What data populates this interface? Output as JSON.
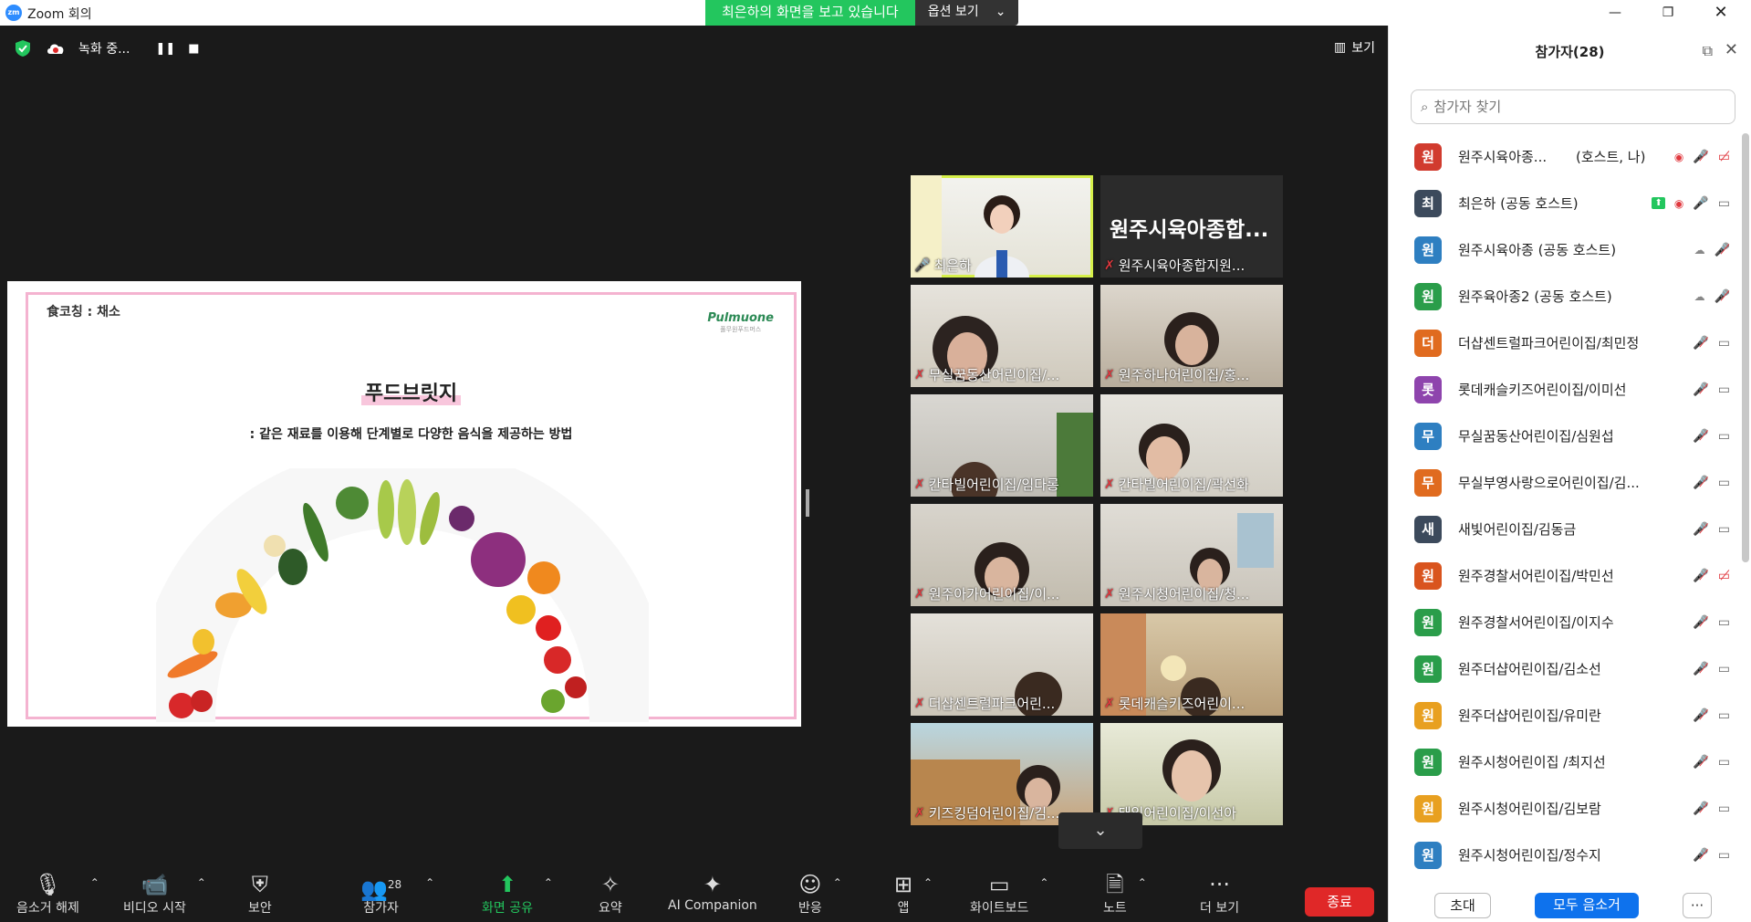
{
  "window": {
    "title": "Zoom 회의",
    "logo_text": "zm"
  },
  "share_banner": {
    "message": "최은하의 화면을 보고 있습니다",
    "options_label": "옵션 보기"
  },
  "recording": {
    "status": "녹화 중..."
  },
  "view_button": {
    "label": "보기"
  },
  "slide": {
    "tag": "食코칭 : 채소",
    "brand": "Pulmuone",
    "brand_sub": "풀무원푸드머스",
    "heading": "푸드브릿지",
    "subtitle": ": 같은 재료를 이용해 단계별로 다양한 음식을 제공하는 방법"
  },
  "tiles": [
    {
      "name": "최은하",
      "active_speaker": true
    },
    {
      "name": "원주시육아종합지원...",
      "big": "원주시육아종합..."
    },
    {
      "name": "무실꿈동산어린이집/..."
    },
    {
      "name": "원주하나어린이집/홍..."
    },
    {
      "name": "칸타빌어린이집/임다롱"
    },
    {
      "name": "칸타빌어린이집/곽선화"
    },
    {
      "name": "원주아가어린이집/이..."
    },
    {
      "name": "원주시청어린이집/청..."
    },
    {
      "name": "더샵센트럴파크어린..."
    },
    {
      "name": "롯데캐슬키즈어린이..."
    },
    {
      "name": "키즈킹덤어린이집/김..."
    },
    {
      "name": "태일어린이집/이선아"
    }
  ],
  "toolbar": {
    "audio": "음소거 해제",
    "video": "비디오 시작",
    "security": "보안",
    "participants": "참가자",
    "participants_count": "28",
    "share": "화면 공유",
    "summary": "요약",
    "ai": "AI Companion",
    "reactions": "반응",
    "apps": "앱",
    "whiteboard": "화이트보드",
    "notes": "노트",
    "more": "더 보기",
    "end": "종료"
  },
  "panel": {
    "title": "참가자(28)",
    "search_placeholder": "참가자 찾기",
    "participants": [
      {
        "avatar": "원",
        "color": "#d13b2e",
        "name": "원주시육아종...",
        "role": "(호스트, 나)",
        "icons": "host-self"
      },
      {
        "avatar": "최",
        "color": "#3c4a5c",
        "name": "최은하 (공동 호스트)",
        "icons": "share"
      },
      {
        "avatar": "원",
        "color": "#2e7fc1",
        "name": "원주시육아종 (공동 호스트)",
        "icons": "cohost"
      },
      {
        "avatar": "원",
        "color": "#2a9d4a",
        "name": "원주육아종2 (공동 호스트)",
        "icons": "cohost"
      },
      {
        "avatar": "더",
        "color": "#e06b1f",
        "name": "더샵센트럴파크어린이집/최민정",
        "icons": "muted"
      },
      {
        "avatar": "롯",
        "color": "#8e44ad",
        "name": "롯데캐슬키즈어린이집/이미선",
        "icons": "muted"
      },
      {
        "avatar": "무",
        "color": "#2e7fc1",
        "name": "무실꿈동산어린이집/심원섭",
        "icons": "muted"
      },
      {
        "avatar": "무",
        "color": "#e06b1f",
        "name": "무실부영사랑으로어린이집/김...",
        "icons": "muted"
      },
      {
        "avatar": "새",
        "color": "#3c4a5c",
        "name": "새빛어린이집/김동금",
        "icons": "muted"
      },
      {
        "avatar": "원",
        "color": "#d9541e",
        "name": "원주경찰서어린이집/박민선",
        "icons": "muted-vidoff"
      },
      {
        "avatar": "원",
        "color": "#2a9d4a",
        "name": "원주경찰서어린이집/이지수",
        "icons": "muted"
      },
      {
        "avatar": "원",
        "color": "#2a9d4a",
        "name": "원주더샵어린이집/김소선",
        "icons": "muted"
      },
      {
        "avatar": "원",
        "color": "#e8a020",
        "name": "원주더샵어린이집/유미란",
        "icons": "muted"
      },
      {
        "avatar": "원",
        "color": "#2a9d4a",
        "name": "원주시청어린이집 /최지선",
        "icons": "muted"
      },
      {
        "avatar": "원",
        "color": "#e8a020",
        "name": "원주시청어린이집/김보람",
        "icons": "muted"
      },
      {
        "avatar": "원",
        "color": "#2e7fc1",
        "name": "원주시청어린이집/정수지",
        "icons": "muted"
      }
    ],
    "invite": "초대",
    "mute_all": "모두 음소거",
    "more": "···"
  }
}
